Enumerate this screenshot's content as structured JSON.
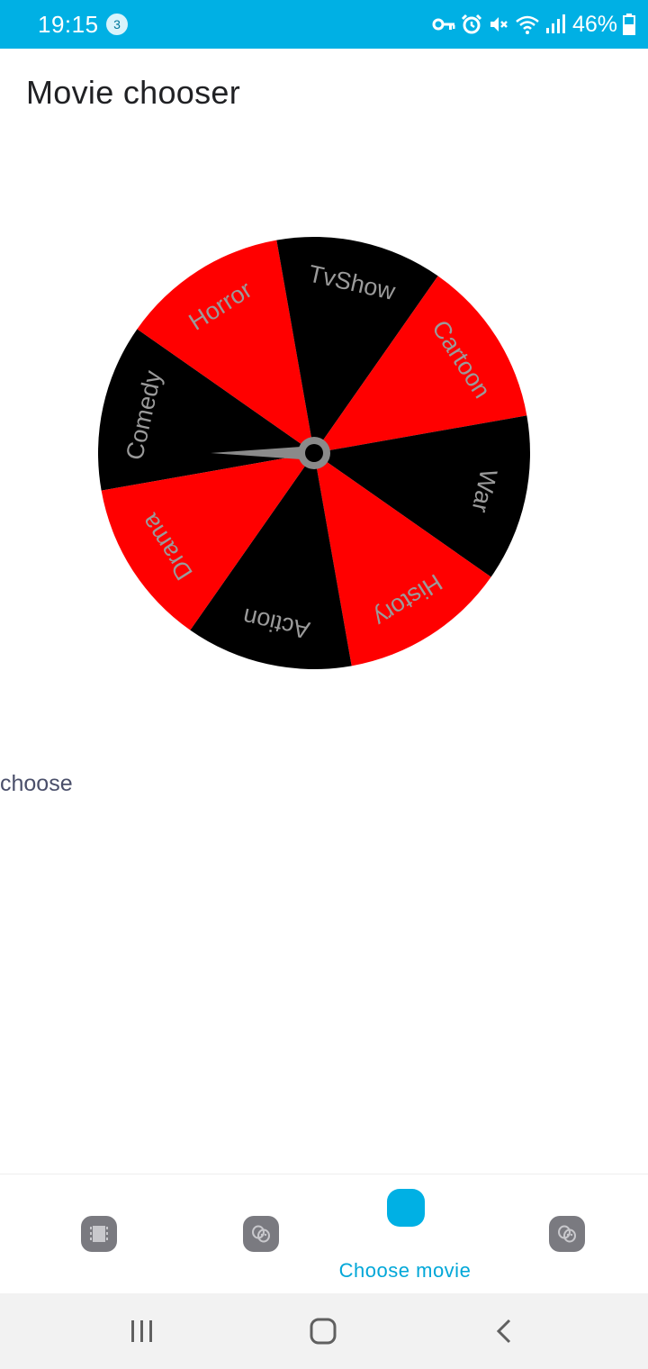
{
  "status_bar": {
    "time": "19:15",
    "notification_count": "3",
    "battery_percent": "46%",
    "icons": [
      "vpn-key-icon",
      "alarm-icon",
      "mute-icon",
      "wifi-icon",
      "signal-icon",
      "battery-icon"
    ],
    "background_color": "#00b0e4"
  },
  "app_bar": {
    "title": "Movie chooser"
  },
  "wheel": {
    "segments": [
      "Comedy",
      "Horror",
      "TvShow",
      "Cartoon",
      "War",
      "History",
      "Action",
      "Drama"
    ],
    "colors": [
      "#000000",
      "#ff0000",
      "#000000",
      "#ff0000",
      "#000000",
      "#ff0000",
      "#000000",
      "#ff0000"
    ],
    "label_color": "#9a9a9a",
    "hub_color": "#8a8a8a",
    "pointer": "needle-pointing-left"
  },
  "main": {
    "choose_label": "choose"
  },
  "bottom_nav": {
    "items": [
      {
        "icon": "film-icon",
        "label": ""
      },
      {
        "icon": "theater-masks-icon",
        "label": ""
      },
      {
        "icon": "choose-movie-icon",
        "label": "Choose movie",
        "active": true
      },
      {
        "icon": "theater-masks-icon",
        "label": ""
      }
    ],
    "active_color": "#00b0e4"
  },
  "system_nav": {
    "buttons": [
      "recent-apps-icon",
      "home-icon",
      "back-icon"
    ]
  }
}
